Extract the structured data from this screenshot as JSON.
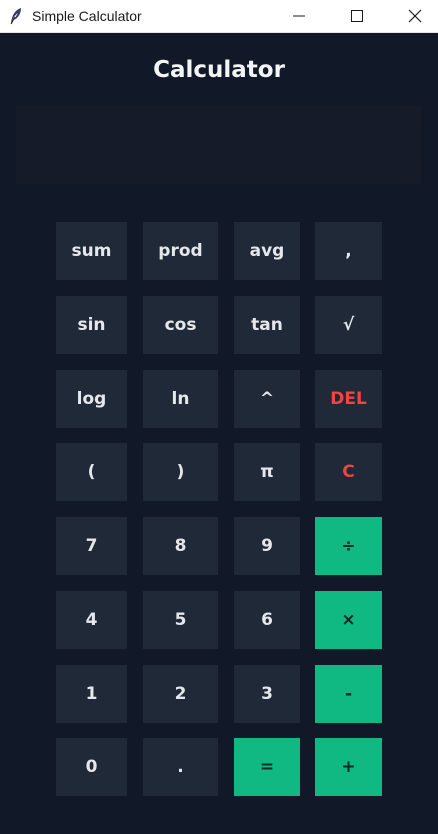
{
  "window": {
    "title": "Simple Calculator",
    "icon": "feather-icon",
    "controls": {
      "minimize": "minimize-icon",
      "maximize": "maximize-icon",
      "close": "close-icon"
    }
  },
  "app": {
    "heading": "Calculator",
    "display_value": ""
  },
  "colors": {
    "background": "#111827",
    "button": "#1f2937",
    "accent": "#10b981",
    "danger": "#ef4444",
    "text": "#e5e7eb"
  },
  "keypad": {
    "sum": "sum",
    "prod": "prod",
    "avg": "avg",
    "comma": ",",
    "sin": "sin",
    "cos": "cos",
    "tan": "tan",
    "sqrt": "√",
    "log": "log",
    "ln": "ln",
    "power": "^",
    "del": "DEL",
    "open_paren": "(",
    "close_paren": ")",
    "pi": "π",
    "clear": "C",
    "seven": "7",
    "eight": "8",
    "nine": "9",
    "divide": "÷",
    "four": "4",
    "five": "5",
    "six": "6",
    "multiply": "×",
    "one": "1",
    "two": "2",
    "three": "3",
    "minus": "-",
    "zero": "0",
    "dot": ".",
    "equals": "=",
    "plus": "+"
  }
}
